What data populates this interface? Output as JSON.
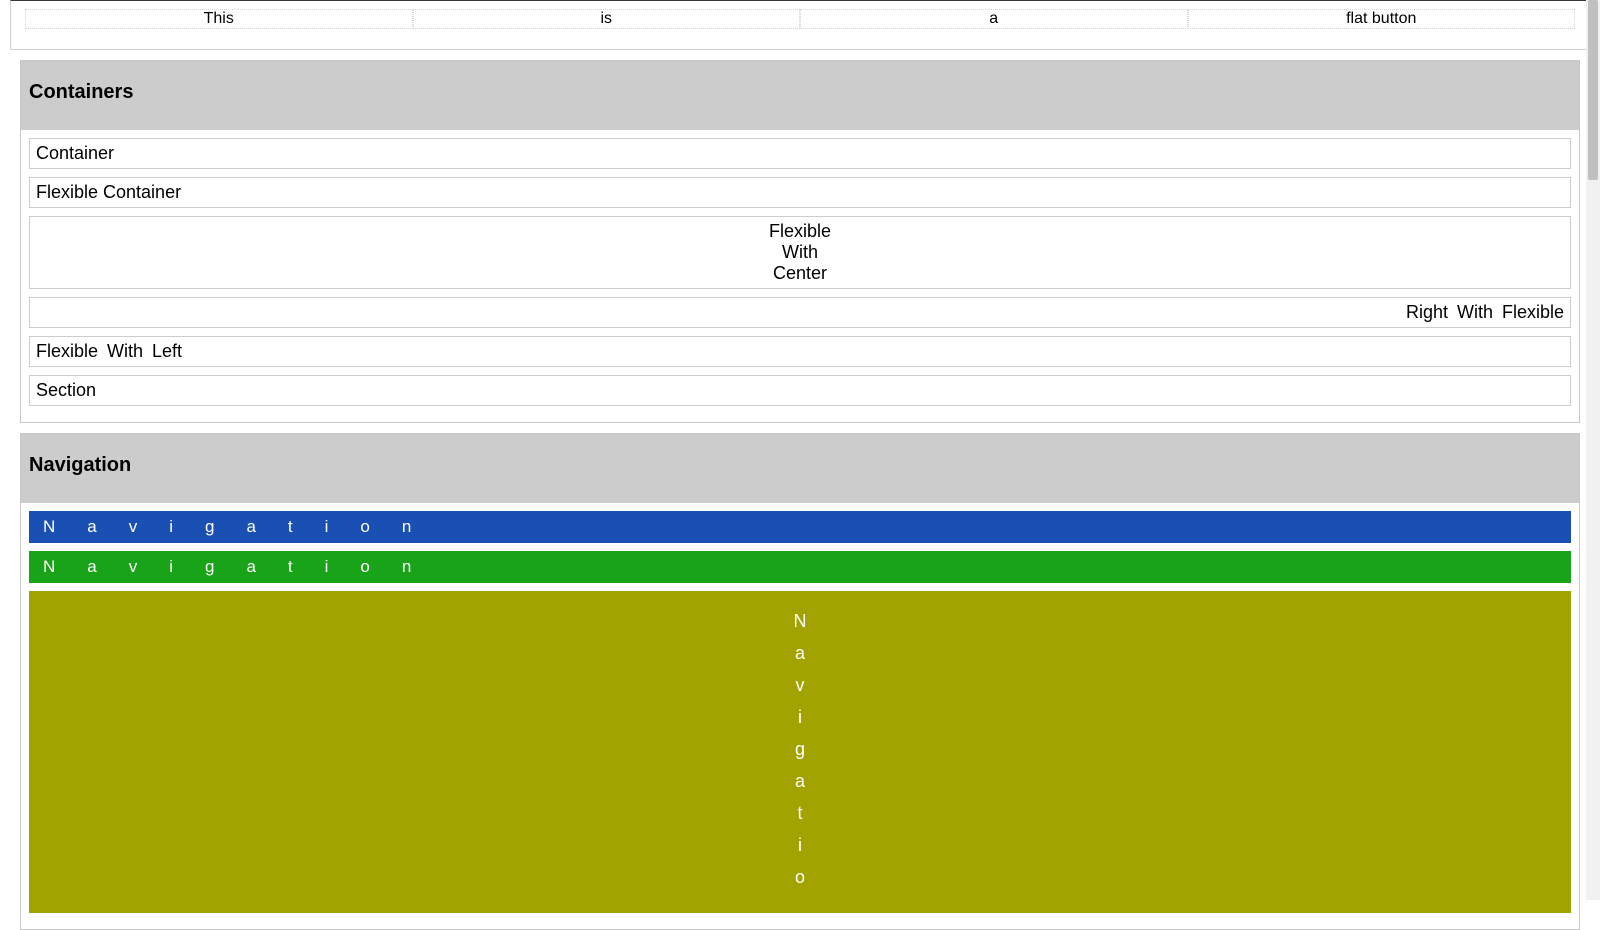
{
  "flat_row": {
    "cells": [
      "This",
      "is",
      "a",
      "flat button"
    ]
  },
  "containers_section": {
    "title": "Containers",
    "items": {
      "container": "Container",
      "flexible_container": "Flexible Container",
      "flexible_center_l1": "Flexible",
      "flexible_center_l2": "With",
      "flexible_center_l3": "Center",
      "flexible_right": "Right  With  Flexible",
      "flexible_left": "Flexible  With  Left",
      "section": "Section"
    }
  },
  "navigation_section": {
    "title": "Navigation",
    "bar_label": "Navigation",
    "colors": {
      "blue": "#1a4fb3",
      "green": "#18a318",
      "olive": "#a2a200"
    }
  }
}
